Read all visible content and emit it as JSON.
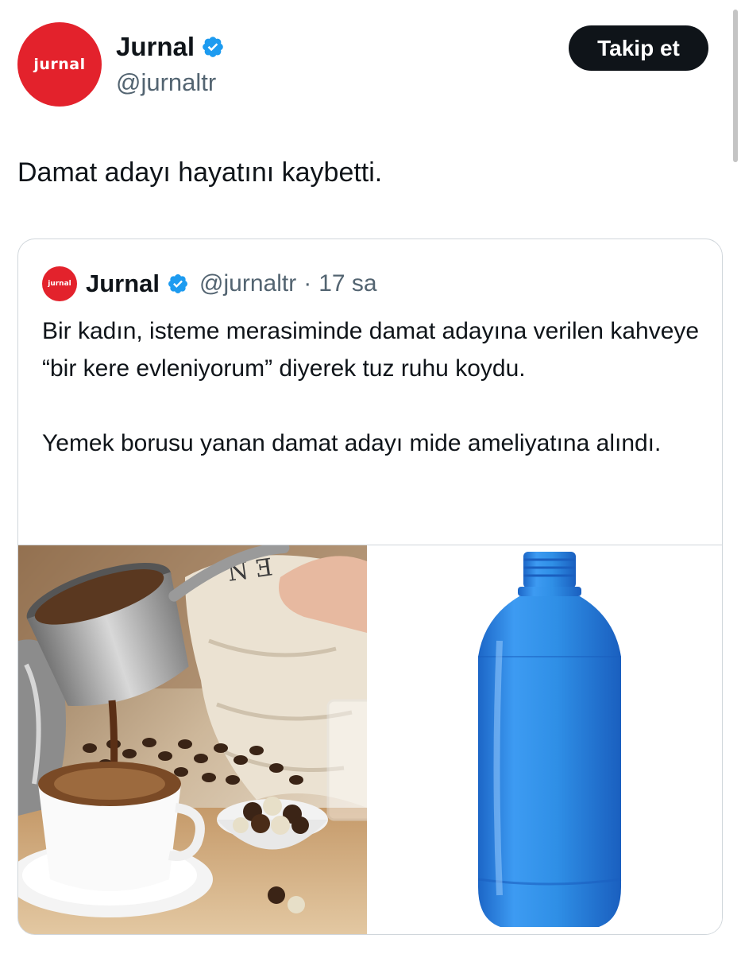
{
  "account": {
    "display_name": "Jurnal",
    "handle": "@jurnaltr",
    "avatar_text": "jurnal",
    "verified_icon": "verified-badge-icon",
    "follow_label": "Takip et"
  },
  "tweet": {
    "text": "Damat adayı hayatını kaybetti."
  },
  "quoted": {
    "display_name": "Jurnal",
    "handle": "@jurnaltr",
    "separator": "·",
    "time": "17 sa",
    "avatar_text": "jurnal",
    "paragraph1": "Bir kadın, isteme merasiminde damat adayına verilen kahveye “bir kere evleniyorum” diyerek tuz ruhu koydu.",
    "paragraph2": "Yemek borusu yanan damat adayı mide ameliyatına alındı.",
    "media": [
      {
        "kind": "photo",
        "subject": "turkish-coffee-photo"
      },
      {
        "kind": "photo",
        "subject": "blue-plastic-bottle-photo"
      }
    ]
  },
  "colors": {
    "brand_red": "#e3222c",
    "verified_blue": "#1d9bf0",
    "text_primary": "#0f1419",
    "text_secondary": "#536471",
    "bottle_blue": "#2f8fe6"
  }
}
